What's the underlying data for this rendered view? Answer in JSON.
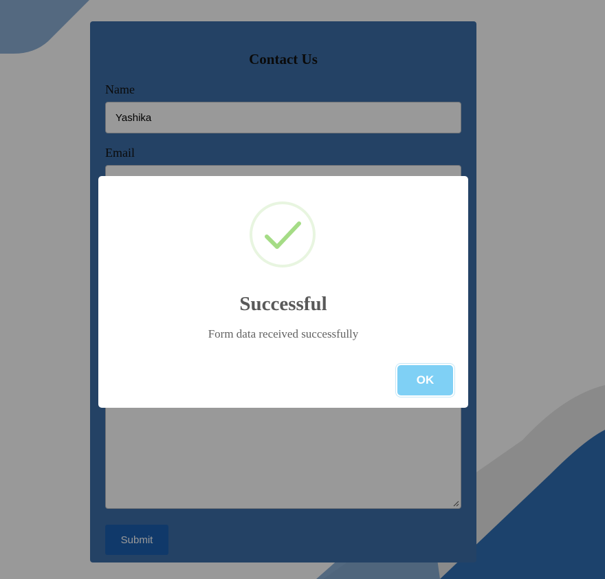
{
  "form": {
    "title": "Contact Us",
    "name_label": "Name",
    "name_value": "Yashika",
    "email_label": "Email",
    "submit_label": "Submit"
  },
  "modal": {
    "icon": "checkmark-icon",
    "title": "Successful",
    "message": "Form data received successfully",
    "ok_label": "OK"
  },
  "colors": {
    "form_card": "#3d6fa8",
    "submit_button": "#1b5fb1",
    "ok_button": "#7fd0f5",
    "success_check": "#a5dc86",
    "background_accent": "#2f6fb5"
  }
}
